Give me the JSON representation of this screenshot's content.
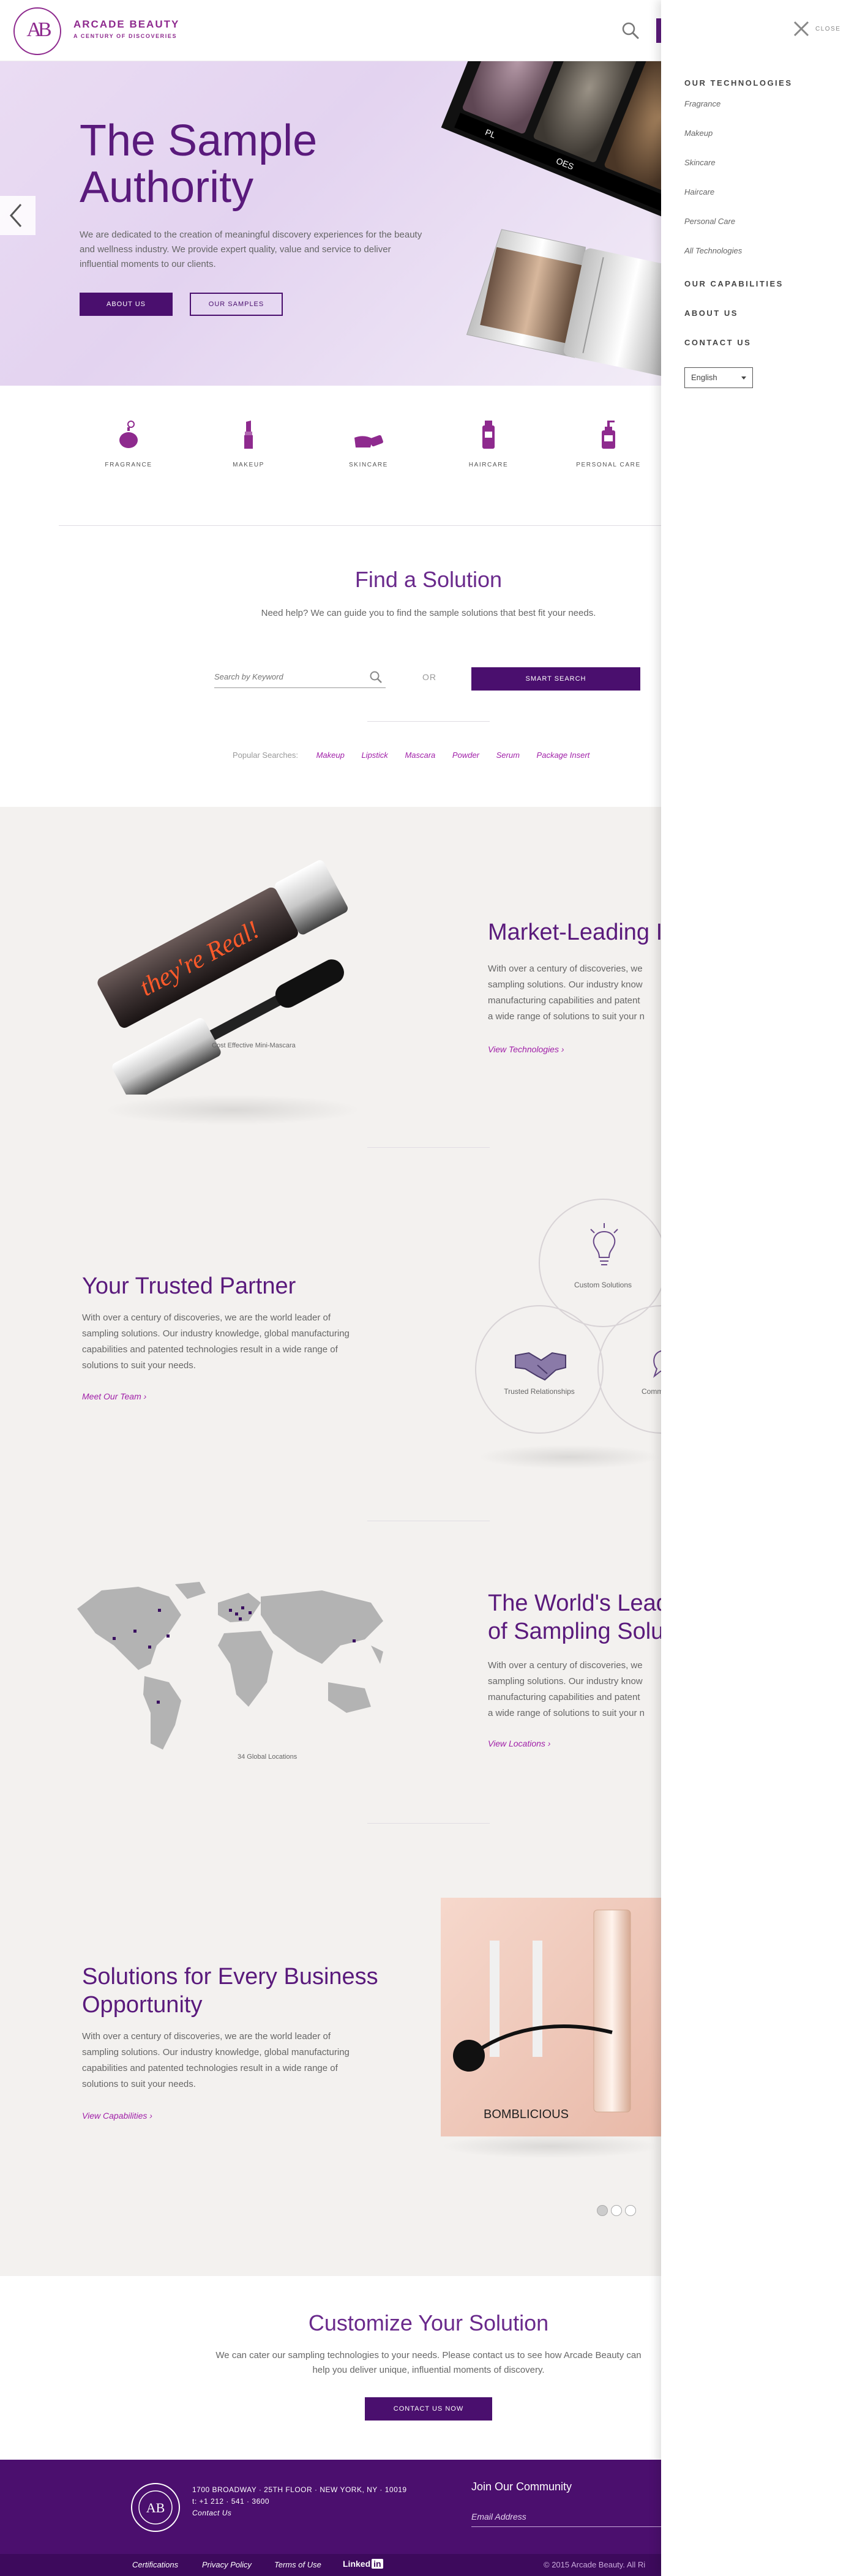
{
  "header": {
    "brand_name": "ARCADE BEAUTY",
    "brand_tagline": "A CENTURY OF DISCOVERIES",
    "logo_monogram": "AB",
    "search_icon": "search-icon"
  },
  "hero": {
    "title": "The Sample Authority",
    "text": "We are dedicated to the creation of meaningful discovery experiences for the beauty and wellness industry. We provide expert quality, value and service to deliver influential moments to our clients.",
    "primary_button": "ABOUT US",
    "secondary_button": "OUR SAMPLES",
    "palette_marks": [
      "PL",
      "OES"
    ]
  },
  "categories": [
    {
      "label": "FRAGRANCE",
      "icon": "perfume-bottle-icon"
    },
    {
      "label": "MAKEUP",
      "icon": "lipstick-icon"
    },
    {
      "label": "SKINCARE",
      "icon": "cream-jar-icon"
    },
    {
      "label": "HAIRCARE",
      "icon": "shampoo-bottle-icon"
    },
    {
      "label": "PERSONAL CARE",
      "icon": "pump-bottle-icon"
    }
  ],
  "find": {
    "title": "Find a Solution",
    "text": "Need help? We can guide you to find the sample solutions that best fit your needs.",
    "search_placeholder": "Search by Keyword",
    "or_label": "OR",
    "smart_search": "SMART SEARCH",
    "popular_label": "Popular Searches:",
    "popular": [
      "Makeup",
      "Lipstick",
      "Mascara",
      "Powder",
      "Serum",
      "Package Insert"
    ]
  },
  "features": {
    "market": {
      "title": "Market-Leading I",
      "text_lines": [
        "With over a century of discoveries, we",
        "sampling solutions. Our industry know",
        "manufacturing capabilities and patent",
        "a wide range of solutions to suit your n"
      ],
      "link": "View Technologies",
      "caption": "Cost Effective Mini-Mascara",
      "product_text": "they're Real!"
    },
    "partner": {
      "title": "Your Trusted Partner",
      "text": "With over a century of discoveries, we are the world leader of sampling solutions. Our industry knowledge, global manufacturing capabilities and patented technologies result in a wide range of solutions to suit your needs.",
      "link": "Meet Our Team",
      "circles": [
        "Custom Solutions",
        "Trusted Relationships",
        "Comm"
      ]
    },
    "world": {
      "title_lines": [
        "The World's Lead",
        "of Sampling Solut"
      ],
      "text_lines": [
        "With over a century of discoveries, we",
        "sampling solutions. Our industry know",
        "manufacturing capabilities and patent",
        "a wide range of solutions to suit your n"
      ],
      "link": "View Locations",
      "caption": "34 Global Locations"
    },
    "business": {
      "title": "Solutions for Every Business Opportunity",
      "text": "With over a century of discoveries, we are the world leader of sampling solutions. Our industry knowledge, global manufacturing capabilities and patented technologies result in a wide range of solutions to suit your needs.",
      "link": "View Capabilities",
      "product_text": "BOMBLICIOUS"
    }
  },
  "customize": {
    "title": "Customize Your Solution",
    "text_line1": "We can cater our sampling technologies to your needs. Please contact us to see how Arcade Beauty can",
    "text_line2": "help you deliver unique, influential moments of discovery.",
    "button": "CONTACT US NOW"
  },
  "footer": {
    "address": "1700 BROADWAY · 25TH FLOOR · NEW YORK, NY · 10019",
    "phone": "t: +1 212 · 541 · 3600",
    "contact": "Contact Us",
    "join": "Join Our Community",
    "email_placeholder": "Email Address",
    "links": [
      "Certifications",
      "Privacy Policy",
      "Terms of Use"
    ],
    "linkedin": "Linked",
    "linkedin_in": "in",
    "copyright": "© 2015 Arcade Beauty. All Ri",
    "logo_ring_text": "ARCADE BEAUTY"
  },
  "sidemenu": {
    "close": "CLOSE",
    "technologies": "OUR TECHNOLOGIES",
    "tech_items": [
      "Fragrance",
      "Makeup",
      "Skincare",
      "Haircare",
      "Personal Care",
      "All Technologies"
    ],
    "capabilities": "OUR CAPABILITIES",
    "about": "ABOUT US",
    "contact": "CONTACT US",
    "language": "English"
  },
  "colors": {
    "brand_purple": "#4a0f6e",
    "accent_magenta": "#a01fa8",
    "title_purple": "#5a1a7c"
  }
}
